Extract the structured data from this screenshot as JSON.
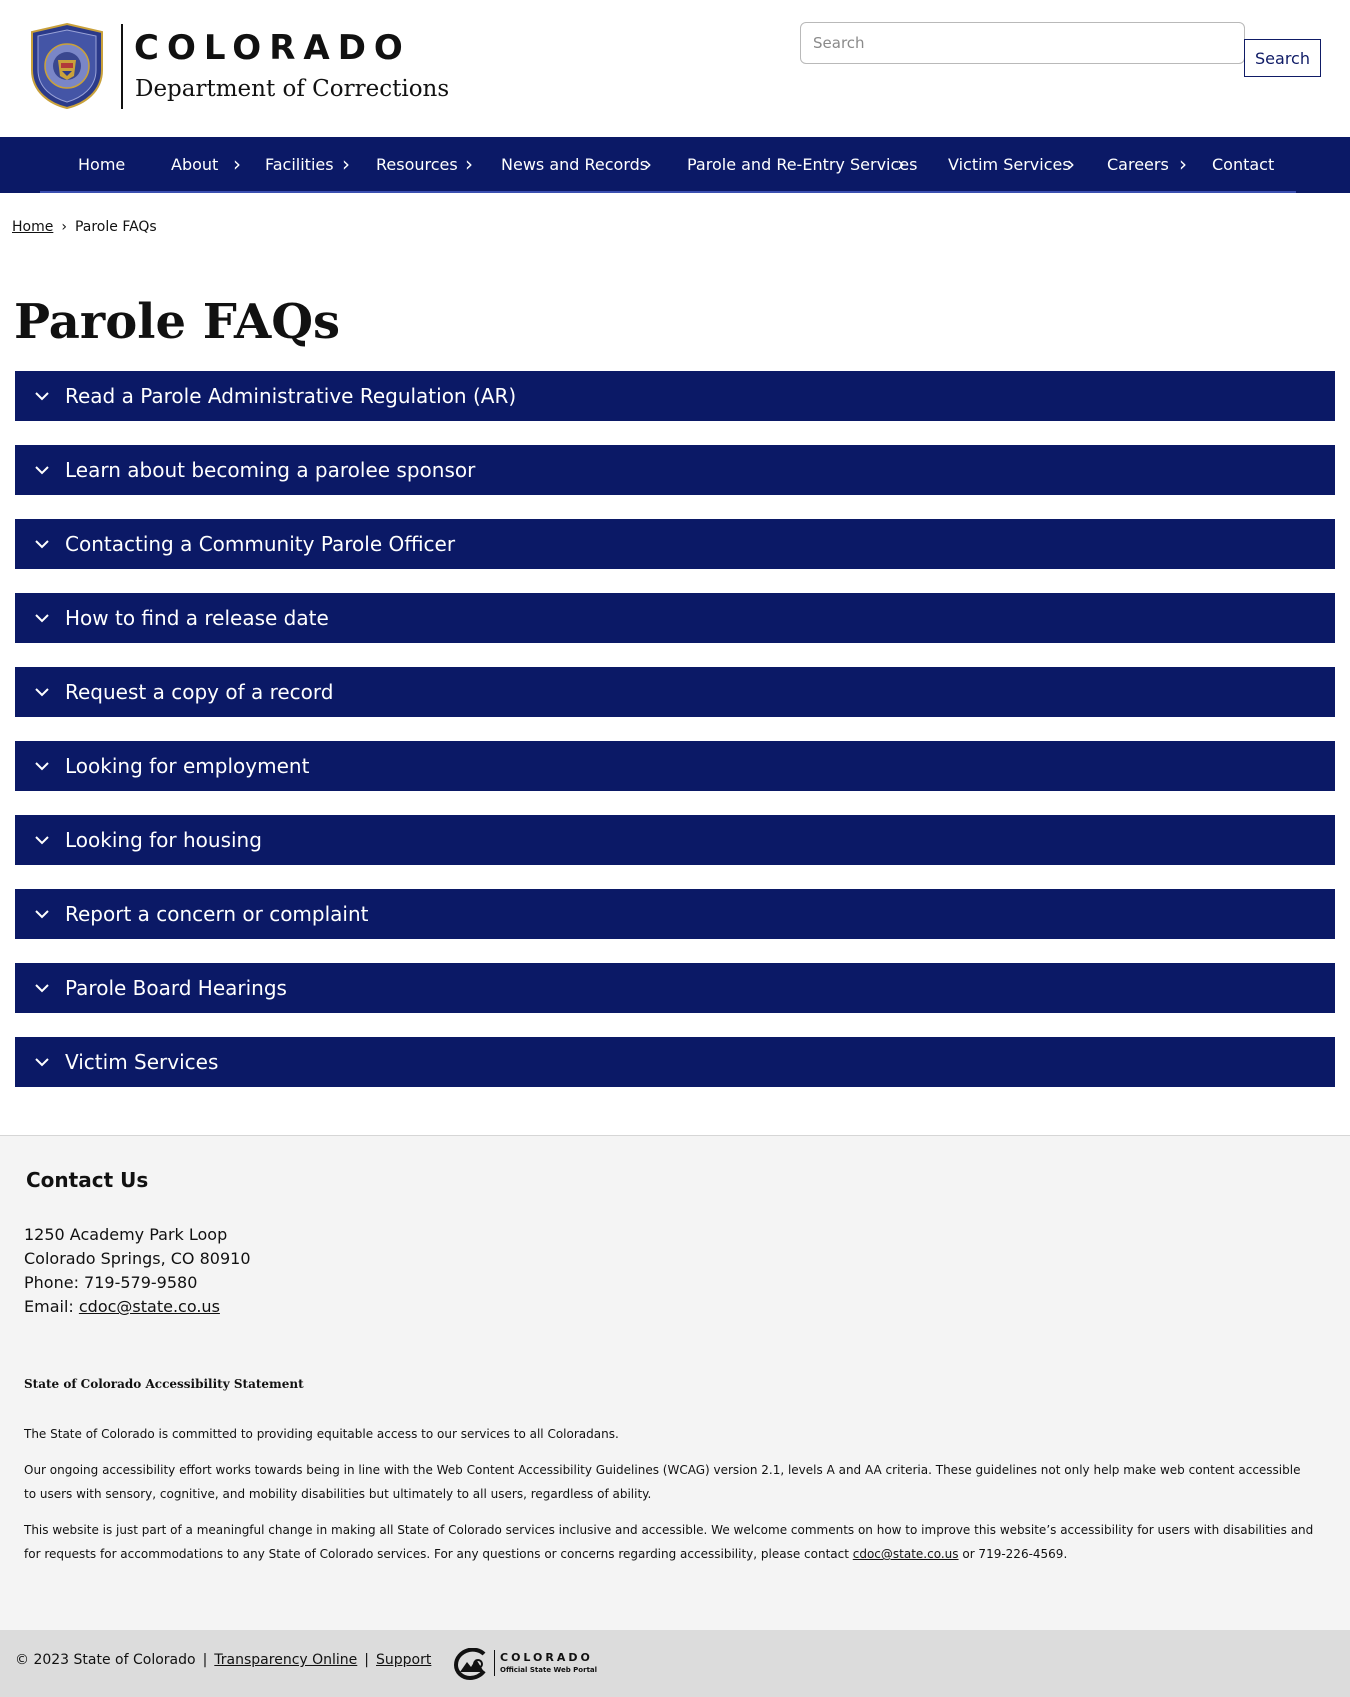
{
  "header": {
    "brand_state": "COLORADO",
    "brand_department": "Department of Corrections",
    "search_placeholder": "Search",
    "search_button": "Search"
  },
  "nav": {
    "items": [
      {
        "label": "Home",
        "has_submenu": false
      },
      {
        "label": "About",
        "has_submenu": true
      },
      {
        "label": "Facilities",
        "has_submenu": true
      },
      {
        "label": "Resources",
        "has_submenu": true
      },
      {
        "label": "News and Records",
        "has_submenu": true
      },
      {
        "label": "Parole and Re-Entry Services",
        "has_submenu": true
      },
      {
        "label": "Victim Services",
        "has_submenu": true
      },
      {
        "label": "Careers",
        "has_submenu": true
      },
      {
        "label": "Contact",
        "has_submenu": false
      }
    ],
    "chevron": "›"
  },
  "breadcrumb": {
    "home": "Home",
    "separator": "›",
    "current": "Parole FAQs"
  },
  "page_title": "Parole FAQs",
  "accordion": {
    "items": [
      "Read a Parole Administrative Regulation (AR)",
      "Learn about becoming a parolee sponsor",
      "Contacting a Community Parole Officer",
      "How to find a release date",
      "Request a copy of a record",
      "Looking for employment",
      "Looking for housing",
      "Report a concern or complaint",
      "Parole Board Hearings",
      "Victim Services"
    ]
  },
  "footer": {
    "contact_heading": "Contact Us",
    "address_line1": "1250 Academy Park Loop",
    "address_line2": "Colorado Springs, CO 80910",
    "phone": "Phone: 719-579-9580",
    "email_label": "Email: ",
    "email": "cdoc@state.co.us",
    "accessibility_title": "State of Colorado Accessibility Statement",
    "accessibility_p1": "The State of Colorado is committed to providing equitable access to our services to all Coloradans.",
    "accessibility_p2": "Our ongoing accessibility effort works towards being in line with the Web Content Accessibility Guidelines (WCAG) version 2.1, levels A and AA criteria. These guidelines not only help make web content accessible to users with sensory, cognitive, and mobility disabilities but ultimately to all users, regardless of ability.",
    "accessibility_p3_before": "This website is just part of a meaningful change in making all State of Colorado services inclusive and accessible. We welcome comments on how to improve this website’s accessibility for users with disabilities and for requests for accommodations to any State of Colorado services. For any questions or concerns regarding accessibility, please contact ",
    "accessibility_p3_email": "cdoc@state.co.us",
    "accessibility_p3_after": " or 719-226-4569.",
    "copyright": "© 2023 State of Colorado",
    "pipe": "|",
    "link_transparency": "Transparency Online",
    "link_support": "Support",
    "portal_state": "COLORADO",
    "portal_sub": "Official State Web Portal"
  },
  "colors": {
    "navy": "#0b1966",
    "footer_bg": "#f4f4f4",
    "footer_bottom_bg": "#dcdcdc",
    "seal_gold": "#c9a13b",
    "seal_blue": "#2b3a8a"
  },
  "icons": {
    "seal": "state-seal-icon",
    "accordion_toggle": "chevron-down-icon",
    "portal_logo": "colorado-c-logo-icon"
  }
}
